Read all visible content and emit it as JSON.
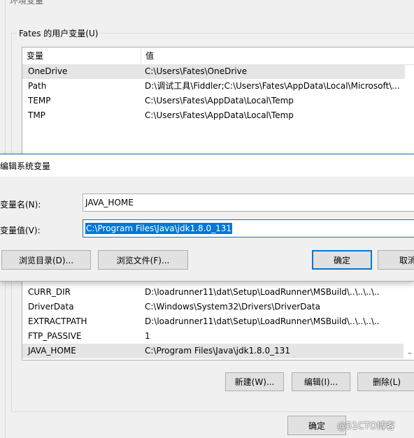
{
  "background_dialog": {
    "title": "环境变量",
    "user_vars": {
      "group_label": "Fates 的用户变量(U)",
      "columns": [
        "变量",
        "值"
      ],
      "rows": [
        {
          "name": "OneDrive",
          "value": "C:\\Users\\Fates\\OneDrive"
        },
        {
          "name": "Path",
          "value": "D:\\调试工具\\Fiddler;C:\\Users\\Fates\\AppData\\Local\\Microsoft\\..."
        },
        {
          "name": "TEMP",
          "value": "C:\\Users\\Fates\\AppData\\Local\\Temp"
        },
        {
          "name": "TMP",
          "value": "C:\\Users\\Fates\\AppData\\Local\\Temp"
        }
      ]
    },
    "system_vars": {
      "rows": [
        {
          "name": "CURR_DIR",
          "value": "D:\\loadrunner11\\dat\\Setup\\LoadRunner\\MSBuild\\..\\..\\..\\.."
        },
        {
          "name": "DriverData",
          "value": "C:\\Windows\\System32\\Drivers\\DriverData"
        },
        {
          "name": "EXTRACTPATH",
          "value": "D:\\loadrunner11\\dat\\Setup\\LoadRunner\\MSBuild\\..\\..\\..\\.."
        },
        {
          "name": "FTP_PASSIVE",
          "value": "1"
        },
        {
          "name": "JAVA_HOME",
          "value": "C:\\Program Files\\Java\\jdk1.8.0_131"
        }
      ],
      "buttons": {
        "new": "新建(W)...",
        "edit": "编辑(I)...",
        "delete": "删除(L)"
      }
    },
    "ok_label": "确定"
  },
  "edit_dialog": {
    "title": "编辑系统变量",
    "name_label": "变量名(N):",
    "name_value": "JAVA_HOME",
    "value_label": "变量值(V):",
    "value_value": "C:\\Program Files\\Java\\jdk1.8.0_131",
    "buttons": {
      "browse_dir": "浏览目录(D)...",
      "browse_file": "浏览文件(F)...",
      "ok": "确定",
      "cancel": "取消"
    }
  },
  "watermark": "@51CTO博客",
  "colors": {
    "accent": "#0078d7",
    "selection": "#e5e5e5",
    "window_bg": "#f0f0f0"
  },
  "icons": {
    "scroll_down": "chevron-down-icon"
  }
}
